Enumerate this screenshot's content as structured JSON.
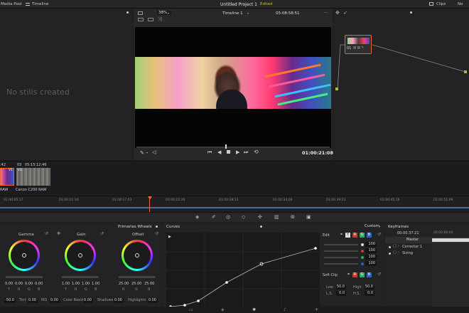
{
  "topbar": {
    "media_pool": "Media Pool",
    "timeline": "Timeline",
    "project_title": "Untitled Project 1",
    "edited": "Edited",
    "clips": "Clips",
    "nodes": "No"
  },
  "viewer": {
    "zoom": "38%",
    "timeline_name": "Timeline 1",
    "source_timecode": "05:08:58:51",
    "record_timecode": "01:00:21:08"
  },
  "stills": {
    "empty_message": "No stills created"
  },
  "node_editor": {
    "node_label": "01"
  },
  "clips": {
    "clip1_tc": ":42",
    "clip1_track": "V1",
    "clip1_codec": "RAW",
    "clip2_index": "03",
    "clip2_tc": "05:15:12:46",
    "clip2_track": "V1",
    "clip2_name": "Canon C200 RAW"
  },
  "timeline_ruler": [
    "01:00:05:17",
    "01:00:11:10",
    "01:00:17:03",
    "01:00:22:20",
    "01:00:28:13",
    "01:00:34:06",
    "01:00:39:23",
    "01:00:45:16",
    "01:00:51:09"
  ],
  "primaries": {
    "title": "Primaries Wheels",
    "wheels": [
      {
        "label": "Gamma",
        "vals": [
          "0.00",
          "0.00",
          "0.00",
          "0.00"
        ],
        "chan": [
          "Y",
          "R",
          "G",
          "B"
        ]
      },
      {
        "label": "Gain",
        "vals": [
          "1.00",
          "1.00",
          "1.00",
          "1.00"
        ],
        "chan": [
          "Y",
          "R",
          "G",
          "B"
        ]
      },
      {
        "label": "Offset",
        "vals": [
          "25.00",
          "25.00",
          "25.00"
        ],
        "chan": [
          "R",
          "G",
          "B"
        ]
      }
    ],
    "bottom": {
      "temp_val": "-50.0",
      "tint_label": "Tint",
      "tint_val": "0.00",
      "md_label": "MD",
      "md_val": "0.00",
      "cboost_label": "Color Boost",
      "cboost_val": "0.00",
      "shadows_label": "Shadows",
      "shadows_val": "0.00",
      "highlights_label": "Highlights",
      "highlights_val": "0.00"
    }
  },
  "curves": {
    "title": "Curves",
    "mode": "Custom",
    "edit_label": "Edit",
    "channel_vals": [
      "100",
      "100",
      "100",
      "100"
    ],
    "soft_clip": "Soft Clip",
    "low_label": "Low",
    "low_val": "50.0",
    "high_label": "High",
    "high_val": "50.0",
    "ls_label": "L.S.",
    "ls_val": "0.0",
    "hs_label": "H.S.",
    "hs_val": "0.0",
    "chips": [
      "Y",
      "R",
      "G",
      "B"
    ]
  },
  "keyframes": {
    "title": "Keyframes",
    "timecode": "00:00:37:21",
    "ruler": "00:00:00:00",
    "rows": [
      "Master",
      "Corrector 1",
      "Sizing"
    ]
  },
  "colors": {
    "accent_orange": "#e8662b",
    "edited_yellow": "#d2b43a"
  }
}
